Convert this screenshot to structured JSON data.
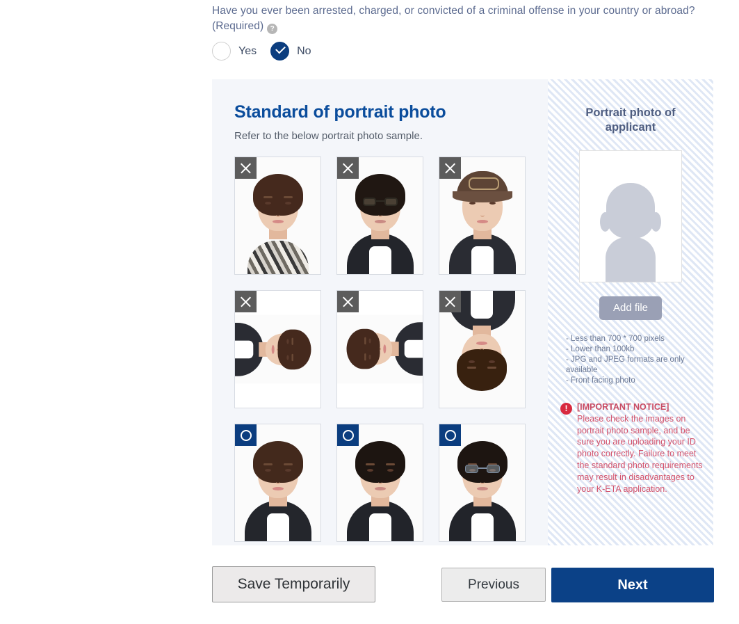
{
  "question": {
    "text": "Have you ever been arrested, charged, or convicted of a criminal offense in your country or abroad? (Required)",
    "help_icon": "?",
    "options": [
      {
        "label": "Yes",
        "selected": false
      },
      {
        "label": "No",
        "selected": true
      }
    ]
  },
  "standard": {
    "title": "Standard of portrait photo",
    "subtitle": "Refer to the below portrait photo sample.",
    "samples": [
      {
        "badge": "X",
        "desc": "woman with scarf covering neck"
      },
      {
        "badge": "X",
        "desc": "man wearing sunglasses"
      },
      {
        "badge": "X",
        "desc": "woman wearing a cap"
      },
      {
        "badge": "X",
        "desc": "woman rotated sideways left"
      },
      {
        "badge": "X",
        "desc": "woman rotated sideways right"
      },
      {
        "badge": "X",
        "desc": "woman upside down"
      },
      {
        "badge": "O",
        "desc": "woman front facing correct"
      },
      {
        "badge": "O",
        "desc": "man front facing correct"
      },
      {
        "badge": "O",
        "desc": "man with glasses front facing correct"
      }
    ]
  },
  "applicant": {
    "title": "Portrait photo of applicant",
    "add_file_label": "Add file",
    "requirements": [
      "- Less than 700 * 700 pixels",
      "- Lower than 100kb",
      "- JPG and JPEG formats are only available",
      "- Front facing photo"
    ],
    "notice": {
      "icon": "!",
      "heading": "[IMPORTANT NOTICE]",
      "body": "Please check the images on portrait photo sample, and be sure you are uploading your ID photo correctly. Failure to meet the standard photo requirements may result in disadvantages to your K-ETA application."
    }
  },
  "footer": {
    "save_label": "Save Temporarily",
    "previous_label": "Previous",
    "next_label": "Next"
  },
  "colors": {
    "accent_navy": "#0b4187",
    "title_blue": "#0b4d9c",
    "panel_bg": "#f4f6fa",
    "stripe_blue": "#dfe7f5",
    "notice_red": "#d2526c",
    "badge_bad": "#5c5c5c",
    "badge_good": "#0b3d7f",
    "add_file_bg": "#9aa0b5"
  }
}
